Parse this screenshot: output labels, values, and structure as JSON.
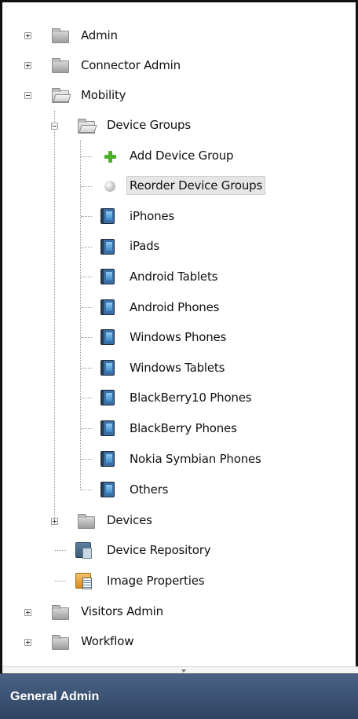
{
  "tree": {
    "admin": "Admin",
    "connector_admin": "Connector Admin",
    "mobility": "Mobility",
    "device_groups": "Device Groups",
    "add_device_group": "Add Device Group",
    "reorder_device_groups": "Reorder Device Groups",
    "groups": [
      "iPhones",
      "iPads",
      "Android Tablets",
      "Android Phones",
      "Windows Phones",
      "Windows Tablets",
      "BlackBerry10 Phones",
      "BlackBerry Phones",
      "Nokia Symbian Phones",
      "Others"
    ],
    "devices": "Devices",
    "device_repository": "Device Repository",
    "image_properties": "Image Properties",
    "visitors_admin": "Visitors Admin",
    "workflow": "Workflow"
  },
  "footer": {
    "title": "General Admin"
  },
  "colors": {
    "footer_bg": "#3b5273",
    "add_icon": "#4caf2a",
    "device_icon": "#3a6ea5"
  }
}
